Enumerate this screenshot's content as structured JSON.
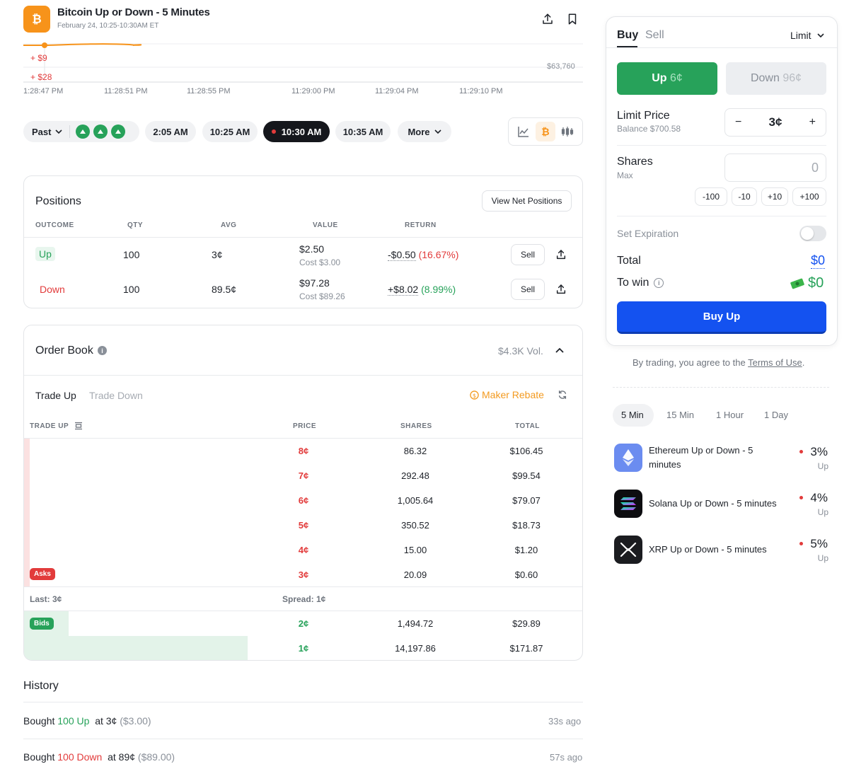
{
  "market": {
    "title": "Bitcoin Up or Down - 5 Minutes",
    "subtitle": "February 24, 10:25-10:30AM ET"
  },
  "chart": {
    "labels": [
      "+ $9",
      "+ $28"
    ],
    "price_label": "$63,760",
    "x_ticks": [
      "1:28:47 PM",
      "11:28:51 PM",
      "11:28:55 PM",
      "11:29:00 PM",
      "11:29:04 PM",
      "11:29:10 PM"
    ]
  },
  "timeline": {
    "past_label": "Past",
    "times": [
      "2:05 AM",
      "10:25 AM",
      "10:30 AM",
      "10:35 AM"
    ],
    "more_label": "More"
  },
  "positions": {
    "title": "Positions",
    "view_net_label": "View Net Positions",
    "columns": [
      "OUTCOME",
      "QTY",
      "AVG",
      "VALUE",
      "RETURN"
    ],
    "rows": [
      {
        "outcome": "Up",
        "qty": "100",
        "avg": "3¢",
        "value": "$2.50",
        "cost": "Cost $3.00",
        "return": "-$0.50",
        "return_pct": "(16.67%)",
        "sell_label": "Sell"
      },
      {
        "outcome": "Down",
        "qty": "100",
        "avg": "89.5¢",
        "value": "$97.28",
        "cost": "Cost $89.26",
        "return": "+$8.02",
        "return_pct": "(8.99%)",
        "sell_label": "Sell"
      }
    ]
  },
  "order_book": {
    "title": "Order Book",
    "volume": "$4.3K Vol.",
    "tab_up": "Trade Up",
    "tab_down": "Trade Down",
    "maker_rebate": "Maker Rebate",
    "columns": [
      "TRADE UP",
      "PRICE",
      "SHARES",
      "TOTAL"
    ],
    "asks_label": "Asks",
    "bids_label": "Bids",
    "asks": [
      {
        "price": "8¢",
        "shares": "86.32",
        "total": "$106.45"
      },
      {
        "price": "7¢",
        "shares": "292.48",
        "total": "$99.54"
      },
      {
        "price": "6¢",
        "shares": "1,005.64",
        "total": "$79.07"
      },
      {
        "price": "5¢",
        "shares": "350.52",
        "total": "$18.73"
      },
      {
        "price": "4¢",
        "shares": "15.00",
        "total": "$1.20"
      },
      {
        "price": "3¢",
        "shares": "20.09",
        "total": "$0.60"
      }
    ],
    "last": "Last: 3¢",
    "spread": "Spread: 1¢",
    "bids": [
      {
        "price": "2¢",
        "shares": "1,494.72",
        "total": "$29.89",
        "depth": 0.08
      },
      {
        "price": "1¢",
        "shares": "14,197.86",
        "total": "$171.87",
        "depth": 0.4
      }
    ]
  },
  "history": {
    "title": "History",
    "rows": [
      {
        "prefix": "Bought",
        "amount": "100 Up",
        "price": "at 3¢",
        "cost": "($3.00)",
        "ago": "33s ago"
      },
      {
        "prefix": "Bought",
        "amount": "100 Down",
        "price": "at 89¢",
        "cost": "($89.00)",
        "ago": "57s ago"
      }
    ]
  },
  "trade": {
    "tab_buy": "Buy",
    "tab_sell": "Sell",
    "order_type": "Limit",
    "up_label": "Up",
    "up_price": "6¢",
    "down_label": "Down",
    "down_price": "96¢",
    "limit_price_label": "Limit Price",
    "balance": "Balance $700.58",
    "limit_value": "3¢",
    "shares_label": "Shares",
    "max_label": "Max",
    "shares_value": "0",
    "quick": [
      "-100",
      "-10",
      "+10",
      "+100"
    ],
    "expiration_label": "Set Expiration",
    "total_label": "Total",
    "total_value": "$0",
    "to_win_label": "To win",
    "to_win_value": "$0",
    "buy_button": "Buy Up",
    "terms_prefix": "By trading, you agree to the",
    "terms_link": "Terms of Use",
    "terms_suffix": "."
  },
  "related": {
    "tabs": [
      "5 Min",
      "15 Min",
      "1 Hour",
      "1 Day"
    ],
    "items": [
      {
        "title": "Ethereum Up or Down - 5 minutes",
        "pct": "3%",
        "side": "Up"
      },
      {
        "title": "Solana Up or Down - 5 minutes",
        "pct": "4%",
        "side": "Up"
      },
      {
        "title": "XRP Up or Down - 5 minutes",
        "pct": "5%",
        "side": "Up"
      }
    ]
  },
  "colors": {
    "green": "#27a25a",
    "red": "#e23b3b",
    "blue": "#1452f0",
    "bitcoin": "#f7931a"
  }
}
